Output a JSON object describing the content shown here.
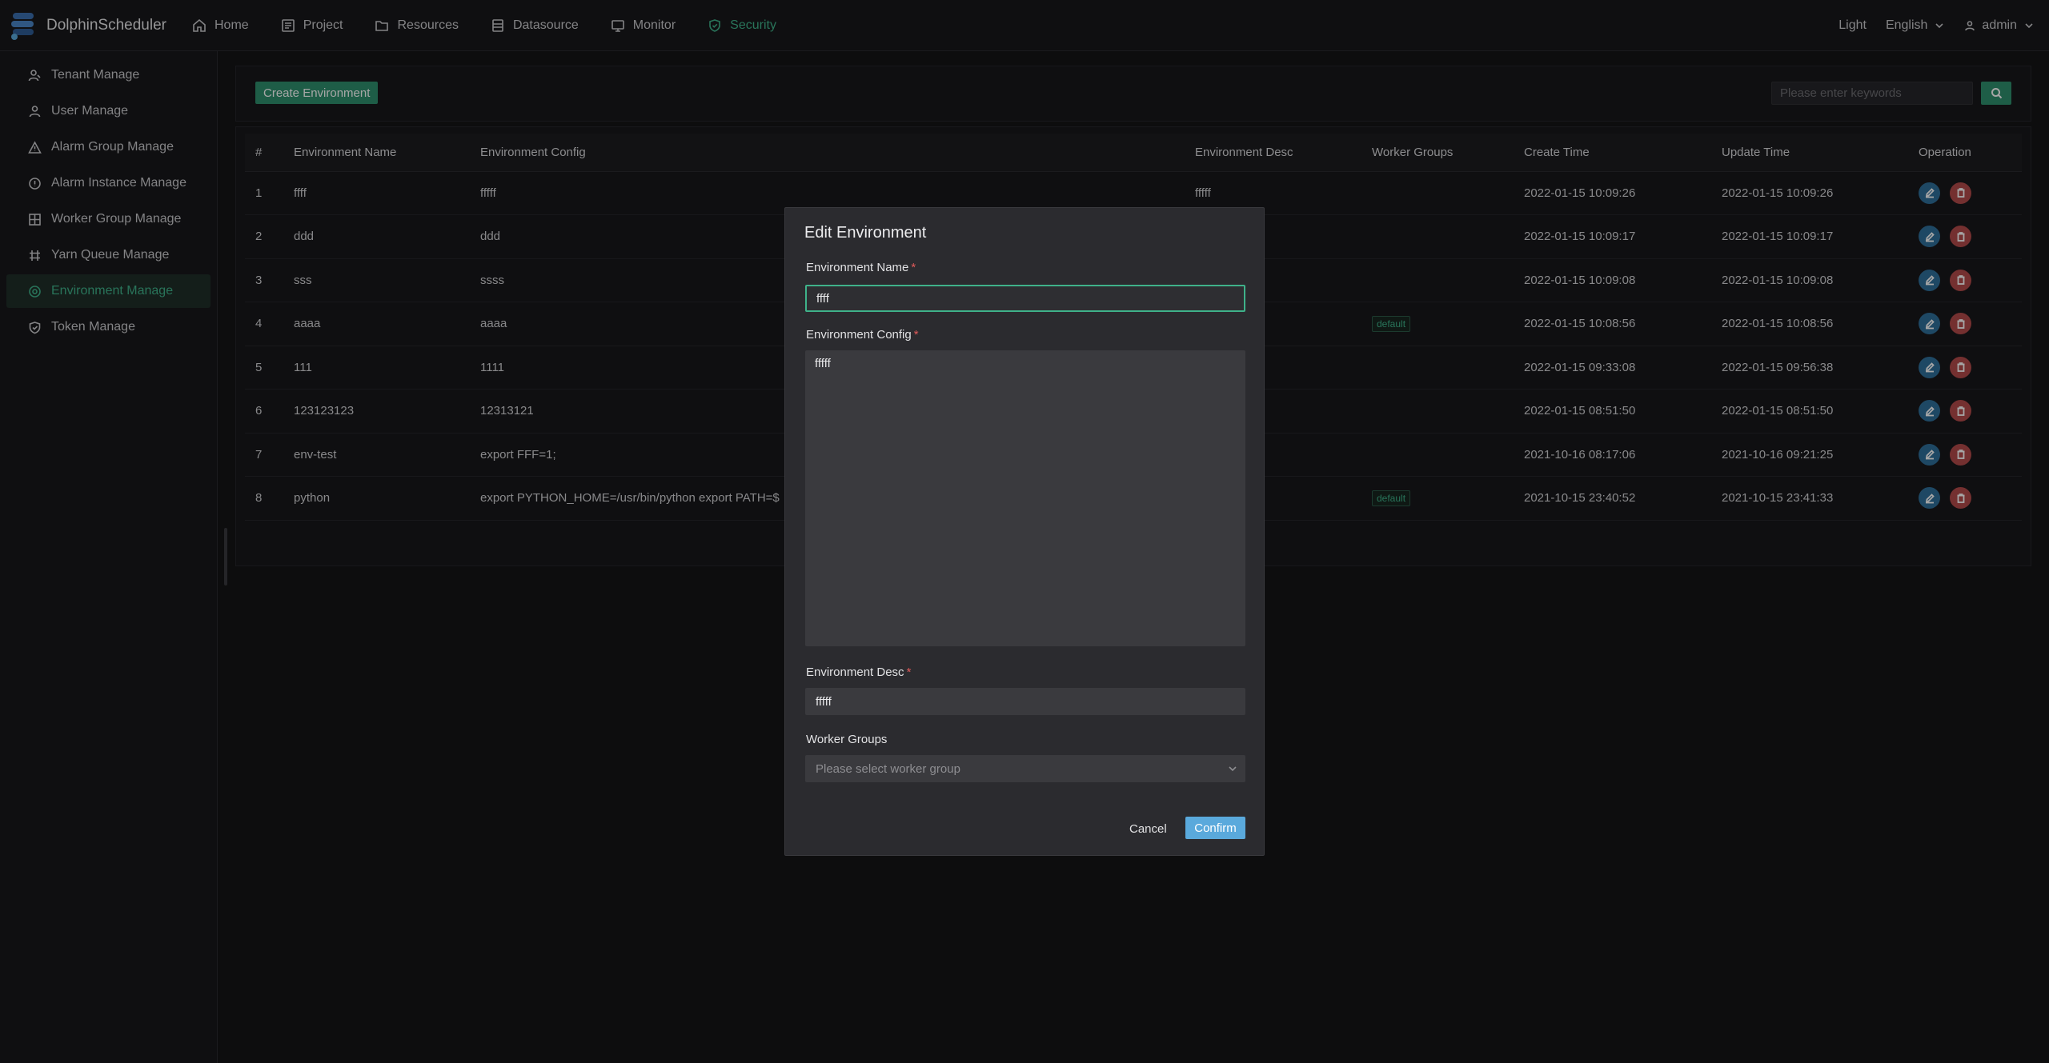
{
  "app": {
    "name": "DolphinScheduler"
  },
  "nav": {
    "items": [
      {
        "label": "Home",
        "icon": "home-icon"
      },
      {
        "label": "Project",
        "icon": "project-icon"
      },
      {
        "label": "Resources",
        "icon": "folder-icon"
      },
      {
        "label": "Datasource",
        "icon": "database-icon"
      },
      {
        "label": "Monitor",
        "icon": "monitor-icon"
      },
      {
        "label": "Security",
        "icon": "shield-icon"
      }
    ],
    "active": "Security"
  },
  "topright": {
    "theme": "Light",
    "language": "English",
    "user": "admin"
  },
  "sidebar": {
    "items": [
      {
        "label": "Tenant Manage",
        "icon": "tenant-icon"
      },
      {
        "label": "User Manage",
        "icon": "user-icon"
      },
      {
        "label": "Alarm Group Manage",
        "icon": "warning-icon"
      },
      {
        "label": "Alarm Instance Manage",
        "icon": "info-icon"
      },
      {
        "label": "Worker Group Manage",
        "icon": "grid-icon"
      },
      {
        "label": "Yarn Queue Manage",
        "icon": "yarn-icon"
      },
      {
        "label": "Environment Manage",
        "icon": "environment-icon"
      },
      {
        "label": "Token Manage",
        "icon": "token-icon"
      }
    ],
    "active": "Environment Manage"
  },
  "toolbar": {
    "create_label": "Create Environment",
    "search_placeholder": "Please enter keywords"
  },
  "table": {
    "headers": [
      "#",
      "Environment Name",
      "Environment Config",
      "Environment Desc",
      "Worker Groups",
      "Create Time",
      "Update Time",
      "Operation"
    ],
    "rows": [
      {
        "idx": "1",
        "name": "ffff",
        "config": "fffff",
        "desc": "fffff",
        "groups": "",
        "create": "2022-01-15 10:09:26",
        "update": "2022-01-15 10:09:26"
      },
      {
        "idx": "2",
        "name": "ddd",
        "config": "ddd",
        "desc": "",
        "groups": "",
        "create": "2022-01-15 10:09:17",
        "update": "2022-01-15 10:09:17"
      },
      {
        "idx": "3",
        "name": "sss",
        "config": "ssss",
        "desc": "",
        "groups": "",
        "create": "2022-01-15 10:09:08",
        "update": "2022-01-15 10:09:08"
      },
      {
        "idx": "4",
        "name": "aaaa",
        "config": "aaaa",
        "desc": "",
        "groups": "default",
        "create": "2022-01-15 10:08:56",
        "update": "2022-01-15 10:08:56"
      },
      {
        "idx": "5",
        "name": "111",
        "config": "1111",
        "desc": "",
        "groups": "",
        "create": "2022-01-15 09:33:08",
        "update": "2022-01-15 09:56:38"
      },
      {
        "idx": "6",
        "name": "123123123",
        "config": "12313121",
        "desc": "",
        "groups": "",
        "create": "2022-01-15 08:51:50",
        "update": "2022-01-15 08:51:50"
      },
      {
        "idx": "7",
        "name": "env-test",
        "config": "export FFF=1;",
        "desc": "",
        "groups": "",
        "create": "2021-10-16 08:17:06",
        "update": "2021-10-16 09:21:25"
      },
      {
        "idx": "8",
        "name": "python",
        "config": "export PYTHON_HOME=/usr/bin/python export PATH=$",
        "desc": "",
        "groups": "default",
        "create": "2021-10-15 23:40:52",
        "update": "2021-10-15 23:41:33"
      }
    ]
  },
  "modal": {
    "title": "Edit Environment",
    "name_label": "Environment Name",
    "name_value": "ffff",
    "config_label": "Environment Config",
    "config_value": "fffff",
    "desc_label": "Environment Desc",
    "desc_value": "fffff",
    "groups_label": "Worker Groups",
    "groups_placeholder": "Please select worker group",
    "required_mark": "*",
    "cancel_label": "Cancel",
    "confirm_label": "Confirm"
  },
  "colors": {
    "accent": "#3fb28a",
    "primary_button": "#2f8f6d",
    "confirm_button": "#5aa9dc",
    "edit_button": "#2f6f9a",
    "delete_button": "#b34a4a"
  }
}
